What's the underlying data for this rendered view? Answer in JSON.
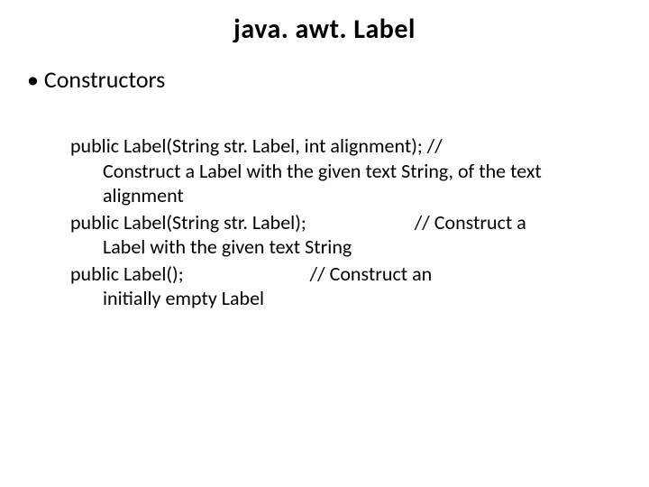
{
  "title": "java. awt. Label",
  "section": "Constructors",
  "entries": [
    {
      "sig": "public Label(String str. Label, int alignment); //",
      "desc": "Construct a Label with the given text String, of the text alignment"
    },
    {
      "sig": "public Label(String str. Label);",
      "comment": "// Construct a",
      "desc": "Label with the given text String"
    },
    {
      "sig": "public Label();",
      "comment": "// Construct an",
      "desc": "initially empty Label"
    }
  ]
}
